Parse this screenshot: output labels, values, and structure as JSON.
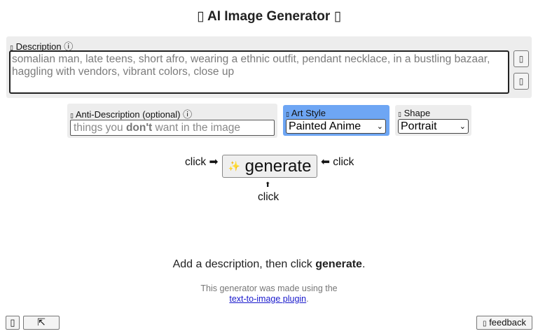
{
  "header": {
    "title": "AI Image Generator",
    "left_icon": "sparkle-icon",
    "right_icon": "sparkle-icon"
  },
  "description": {
    "label": "Description",
    "info_glyph": "ⓘ",
    "value": "somalian man, late teens, short afro, wearing a ethnic outfit, pendant necklace, in a bustling bazaar, haggling with vendors, vibrant colors, close up",
    "buttons": [
      "shuffle-icon",
      "history-icon"
    ]
  },
  "anti_description": {
    "label": "Anti-Description (optional)",
    "info_glyph": "ⓘ",
    "placeholder_pre": "things you ",
    "placeholder_bold": "don't",
    "placeholder_post": " want in the image"
  },
  "art_style": {
    "label": "Art Style",
    "selected": "Painted Anime"
  },
  "shape": {
    "label": "Shape",
    "selected": "Portrait"
  },
  "generate": {
    "label": "generate",
    "sparkle": "✨",
    "left_hint": "click ➡",
    "right_hint": "⬅ click",
    "below_arrow": "⬆",
    "below_hint": "click"
  },
  "status": {
    "pre": "Add a description, then click ",
    "bold": "generate",
    "post": "."
  },
  "credit": {
    "line1": "This generator was made using the",
    "link": "text-to-image plugin",
    "post": "."
  },
  "footer": {
    "feedback_label": "feedback",
    "expand_glyph": "⇱"
  },
  "colors": {
    "art_style_highlight": "#6ea6f4",
    "panel_bg": "#ededed",
    "link": "#1a1acc"
  }
}
